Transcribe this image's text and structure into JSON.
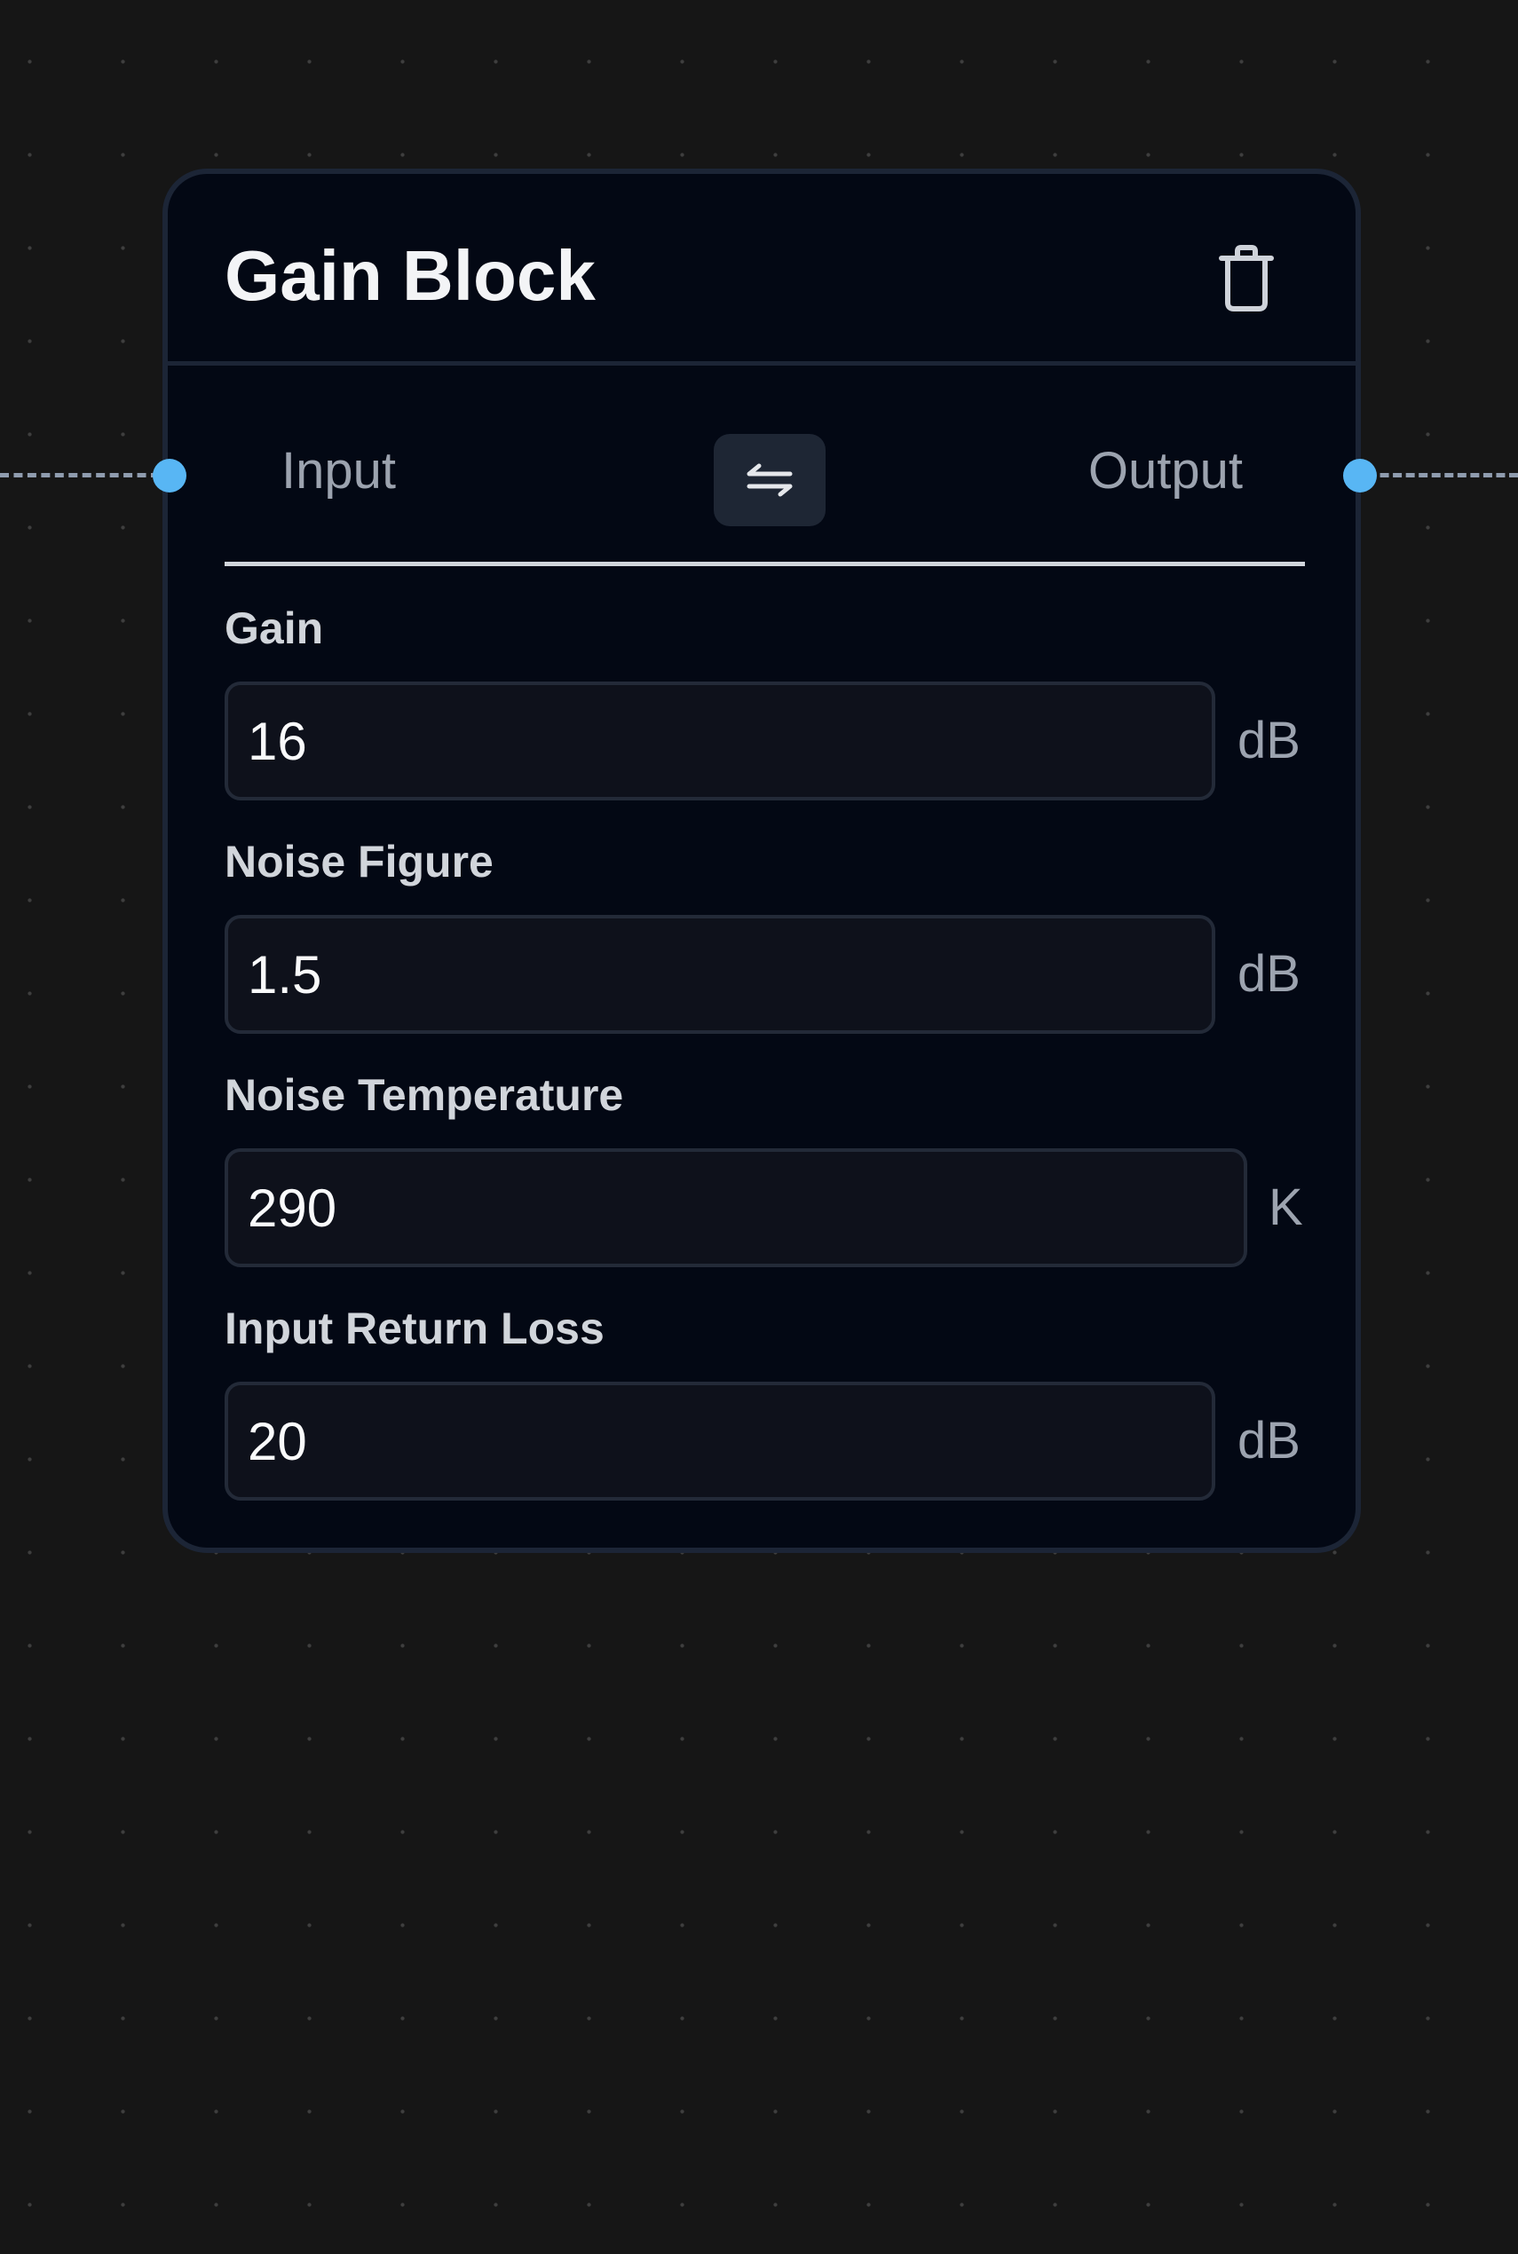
{
  "node": {
    "title": "Gain Block",
    "input_label": "Input",
    "output_label": "Output",
    "icons": {
      "delete": "trash-icon",
      "swap": "swap-arrows-icon"
    },
    "fields": [
      {
        "label": "Gain",
        "value": "16",
        "unit": "dB"
      },
      {
        "label": "Noise Figure",
        "value": "1.5",
        "unit": "dB"
      },
      {
        "label": "Noise Temperature",
        "value": "290",
        "unit": "K"
      },
      {
        "label": "Input Return Loss",
        "value": "20",
        "unit": "dB"
      }
    ]
  },
  "colors": {
    "canvas_background": "#161616",
    "node_background": "#030814",
    "handle": "#58b6f4",
    "edge": "#8f9cae"
  }
}
